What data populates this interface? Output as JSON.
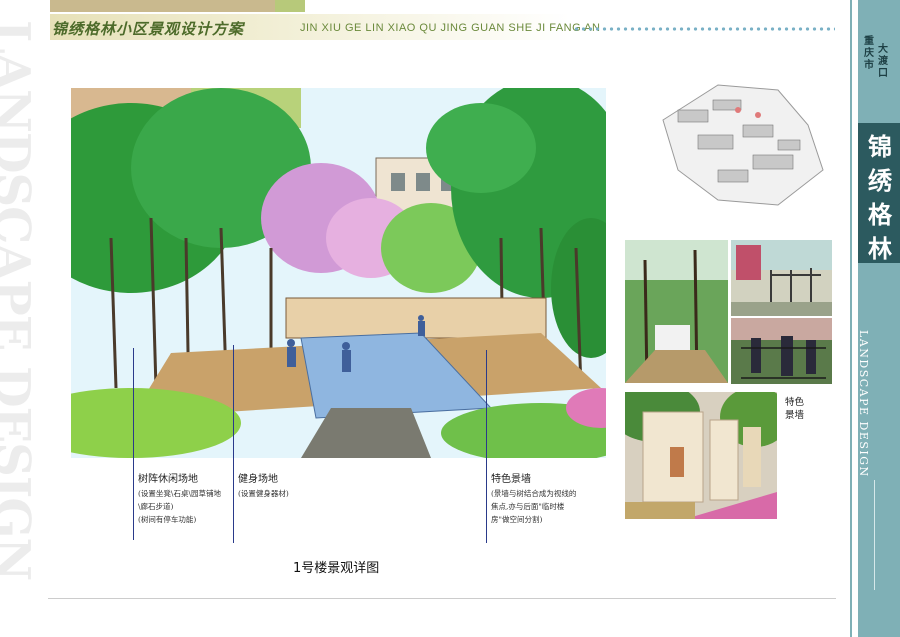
{
  "header": {
    "title_cn": "锦绣格林小区景观设计方案",
    "title_pinyin": "JIN XIU GE LIN XIAO QU JING GUAN SHE JI FANG AN"
  },
  "watermark": "LANDSCAPE DESIGN",
  "sidebar": {
    "city": "重庆市",
    "district": "大渡口",
    "brand": "锦绣格林",
    "english": "LANDSCAPE DESIGN"
  },
  "callouts": [
    {
      "title": "树阵休闲场地",
      "notes": [
        "(设置坐凳\\石桌\\园草铺地",
        "\\廊石步道)",
        "(树间有停车功能)"
      ]
    },
    {
      "title": "健身场地",
      "notes": [
        "(设置健身器材)"
      ]
    },
    {
      "title": "特色景墙",
      "notes": [
        "(景墙与树结合成为视线的",
        "焦点,亦与后面\"临时楼",
        "房\"做空间分割)"
      ]
    }
  ],
  "photo_label": "特色景墙",
  "caption": "1号楼景观详图",
  "colors": {
    "sidebar_teal": "#7fb0b6",
    "sidebar_dark": "#2c5a5f",
    "header_green": "#4d6b2a"
  }
}
